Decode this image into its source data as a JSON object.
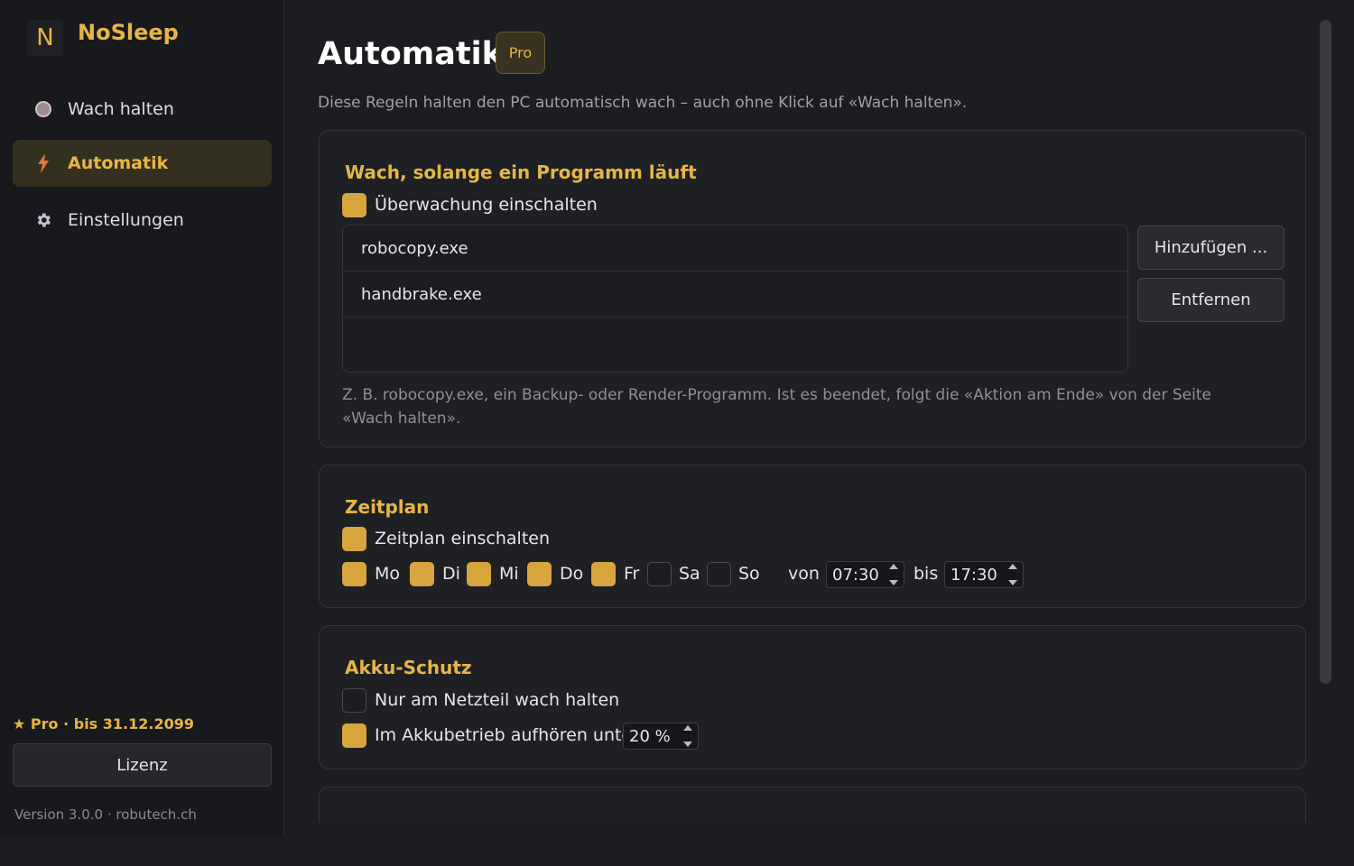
{
  "app": {
    "logo_letter": "N",
    "title": "NoSleep"
  },
  "sidebar": {
    "items": [
      {
        "label": "Wach halten",
        "icon": "coffee-icon"
      },
      {
        "label": "Automatik",
        "icon": "lightning-icon",
        "active": true
      },
      {
        "label": "Einstellungen",
        "icon": "gear-icon"
      }
    ],
    "pro_status": "★ Pro · bis 31.12.2099",
    "license_button": "Lizenz",
    "version": "Version 3.0.0 · robutech.ch"
  },
  "page": {
    "title": "Automatik",
    "badge": "Pro",
    "subtitle": "Diese Regeln halten den PC automatisch wach – auch ohne Klick auf «Wach halten»."
  },
  "program_card": {
    "title": "Wach, solange ein Programm läuft",
    "enable_label": "Überwachung einschalten",
    "enabled": true,
    "programs": [
      "robocopy.exe",
      "handbrake.exe"
    ],
    "add_button": "Hinzufügen ...",
    "remove_button": "Entfernen",
    "hint": "Z. B. robocopy.exe, ein Backup- oder Render-Programm. Ist es beendet, folgt die «Aktion am Ende» von der Seite «Wach halten»."
  },
  "schedule_card": {
    "title": "Zeitplan",
    "enable_label": "Zeitplan einschalten",
    "enabled": true,
    "days": [
      {
        "label": "Mo",
        "checked": true
      },
      {
        "label": "Di",
        "checked": true
      },
      {
        "label": "Mi",
        "checked": true
      },
      {
        "label": "Do",
        "checked": true
      },
      {
        "label": "Fr",
        "checked": true
      },
      {
        "label": "Sa",
        "checked": false
      },
      {
        "label": "So",
        "checked": false
      }
    ],
    "from_label": "von",
    "from_time": "07:30",
    "to_label": "bis",
    "to_time": "17:30"
  },
  "battery_card": {
    "title": "Akku-Schutz",
    "ac_only_label": "Nur am Netzteil wach halten",
    "ac_only": false,
    "stop_below_label": "Im Akkubetrieb aufhören unter",
    "stop_below": true,
    "threshold": "20 %"
  },
  "colors": {
    "accent": "#e6b548",
    "background": "#1c1d21",
    "card": "#1f2024"
  }
}
